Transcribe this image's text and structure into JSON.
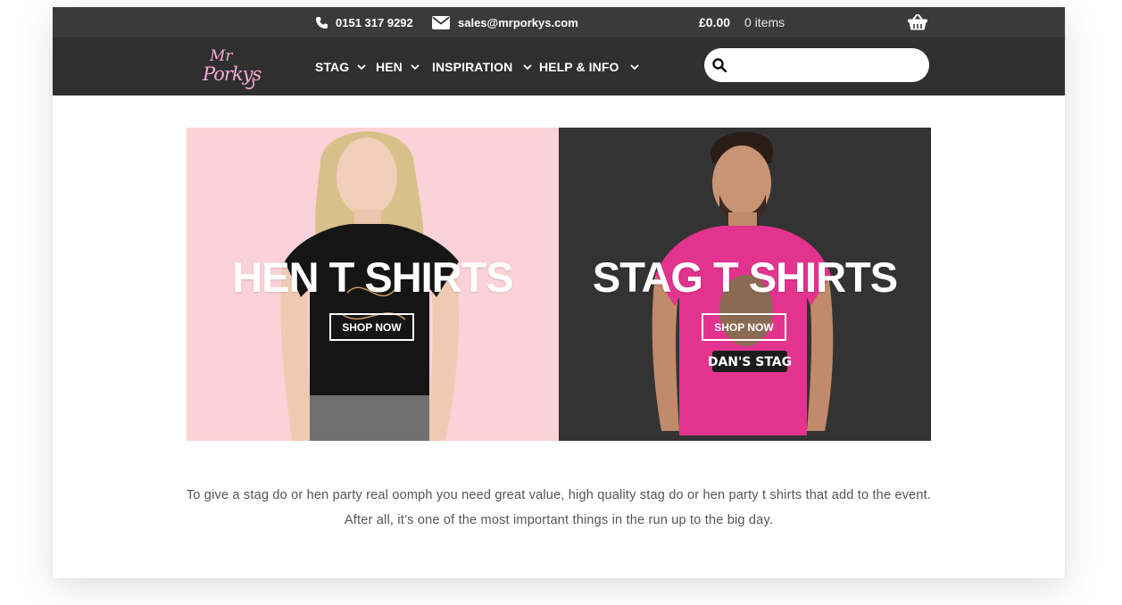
{
  "topbar": {
    "phone": "0151 317 9292",
    "email": "sales@mrporkys.com",
    "cart_total": "£0.00",
    "cart_items": "0 items",
    "icons": [
      "phone-icon",
      "envelope-icon",
      "basket-icon"
    ]
  },
  "header": {
    "logo_line1": "Mr",
    "logo_line2": "Porkys",
    "nav": [
      {
        "label": "STAG"
      },
      {
        "label": "HEN"
      },
      {
        "label": "INSPIRATION"
      },
      {
        "label": "HELP & INFO"
      }
    ],
    "search_placeholder": ""
  },
  "hero": {
    "hen": {
      "title": "HEN T SHIRTS",
      "button": "SHOP NOW",
      "bg": "#fbd2d7"
    },
    "stag": {
      "title": "STAG T SHIRTS",
      "button": "SHOP NOW",
      "bg": "#333333",
      "shirt_print": "DAN'S STAG"
    }
  },
  "intro": {
    "line1": "To give a stag do or hen party real oomph you need great value, high quality stag do or hen party t shirts that add to the event.",
    "line2": "After all, it’s one of the most important things in the run up to the big day."
  },
  "colors": {
    "topbar": "#3a3a3a",
    "navbar": "#2f2f2f",
    "accent_pink": "#ee3e9a"
  }
}
